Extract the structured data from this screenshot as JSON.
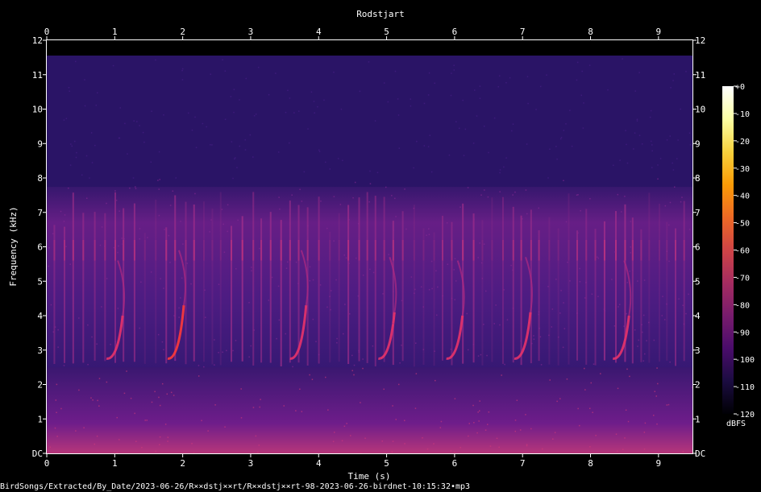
{
  "chart_data": {
    "type": "heatmap",
    "title": "Rodstjart",
    "xlabel": "Time (s)",
    "ylabel": "Frequency (kHz)",
    "xlim": [
      0,
      9.5
    ],
    "ylim": [
      0,
      12
    ],
    "x_ticks": [
      "0",
      "1",
      "2",
      "3",
      "4",
      "5",
      "6",
      "7",
      "8",
      "9"
    ],
    "y_ticks": [
      "DC",
      "1",
      "2",
      "3",
      "4",
      "5",
      "6",
      "7",
      "8",
      "9",
      "10",
      "11",
      "12"
    ],
    "colorbar": {
      "label": "dBFS",
      "range": [
        -120,
        0
      ],
      "ticks": [
        "+0",
        "-10",
        "-20",
        "-30",
        "-40",
        "-50",
        "-60",
        "-70",
        "-80",
        "-90",
        "-100",
        "-110",
        "-120"
      ],
      "colors": [
        "#000004",
        "#1b0c41",
        "#4a0c6b",
        "#781c6d",
        "#a52c60",
        "#cf4446",
        "#ed6925",
        "#fb9b06",
        "#f7d13d",
        "#fcffa4",
        "#ffffff"
      ]
    },
    "background_color": "#000000",
    "song_phrases": [
      {
        "onset_s": 0.95,
        "f_low_khz": 2.8,
        "f_high_khz": 4.0,
        "peak_dbfs": -55
      },
      {
        "onset_s": 1.85,
        "f_low_khz": 2.8,
        "f_high_khz": 4.3,
        "peak_dbfs": -45
      },
      {
        "onset_s": 3.65,
        "f_low_khz": 2.8,
        "f_high_khz": 4.3,
        "peak_dbfs": -55
      },
      {
        "onset_s": 4.95,
        "f_low_khz": 2.8,
        "f_high_khz": 4.1,
        "peak_dbfs": -60
      },
      {
        "onset_s": 5.95,
        "f_low_khz": 2.8,
        "f_high_khz": 4.0,
        "peak_dbfs": -60
      },
      {
        "onset_s": 6.95,
        "f_low_khz": 2.8,
        "f_high_khz": 4.1,
        "peak_dbfs": -55
      },
      {
        "onset_s": 8.4,
        "f_low_khz": 2.8,
        "f_high_khz": 4.0,
        "peak_dbfs": -60
      }
    ]
  },
  "footer": {
    "file_path": "BirdSongs/Extracted/By_Date/2023-06-26/R××dstj××rt/R××dstj××rt-98-2023-06-26-birdnet-10:15:32•mp3"
  }
}
